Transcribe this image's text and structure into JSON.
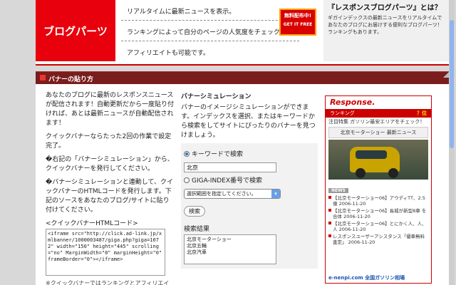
{
  "header": {
    "logo_text": "ブログパーツ",
    "features": [
      "リアルタイムに最新ニュースを表示。",
      "ランキングによって自分のページの人気度をチェック！",
      "アフィリエイトも可能です。"
    ],
    "badge_main": "無料配布中!",
    "badge_sub": "GET IT FREE",
    "about_title": "『レスポンスブログパーツ』とは？",
    "about_body": "ギガインデックスの最新ニュースをリアルタイムであなたのブログにお届けする便利なブログパーツ！ランキングもあります。"
  },
  "section": {
    "title": "バナーの貼り方"
  },
  "left": {
    "p1": "あなたのブログに最新のレスポンスニュースが配信されます！自動更新だから一度貼り付ければ、あとは最新ニュースが自動配信されます！",
    "p2": "クイックバナーならたった2回の作業で設定完了。",
    "p3": "�右記の「バナーシミュレーション」から、クイックバナーを発行してください。",
    "p4": "�バナーシミュレーションと連動して、クイックバナーのHTMLコードを発行します。下記のソースをあなたのブログ/サイトに貼り付けてください。",
    "code_label": "<クイックバナーHTMLコード>",
    "code": "<iframe src=\"http://click.ad-link.jp/xmlbanner/1000003487/giga.php?giga=1072\" width=\"150\" height=\"445\" scrolling=\"no\" MarginWidth=\"0\" marginHeight=\"0\" frameBorder=\"0\"></iframe>",
    "note": "※クイックバナーではランキングとアフィリエイト"
  },
  "sim": {
    "title": "バナーシミュレーション",
    "body": "バナーのイメージシミュレーションができます。インデックスを選択、またはキーワードから検索をしてサイトにぴったりのバナーを見つけましょう。",
    "radio_keyword": "キーワードで検索",
    "keyword_value": "北京",
    "radio_giga": "GIGA-INDEX番号で検索",
    "select_value": "選択範囲を指定してください。",
    "search_button": "検索",
    "results_title": "検索結果",
    "results": [
      "北京モーターショー",
      "北京五輪",
      "北京汽車"
    ]
  },
  "banner": {
    "logo": "Response.",
    "rank_label": "ランキング",
    "rank_value": "？位",
    "pickup": "注目特集 ガソリン最安エリアをチェック！",
    "news_head": "北京モーターショー 最新ニュース",
    "news_tag": "NEWS",
    "news": [
      "【北京モーターショー06】アウディTT、2.5億 2006-11-20",
      "【北京モーターショー06】長城が新型8車 を合体 2006-11-20",
      "【北京モーターショー06】とにかく人、人、人 2006-11-20",
      "レスポンスユーザーアシスタンス「優車無料査定」 2006-11-20"
    ],
    "footer": "e-nenpi.com 全国ガソリン相場"
  }
}
